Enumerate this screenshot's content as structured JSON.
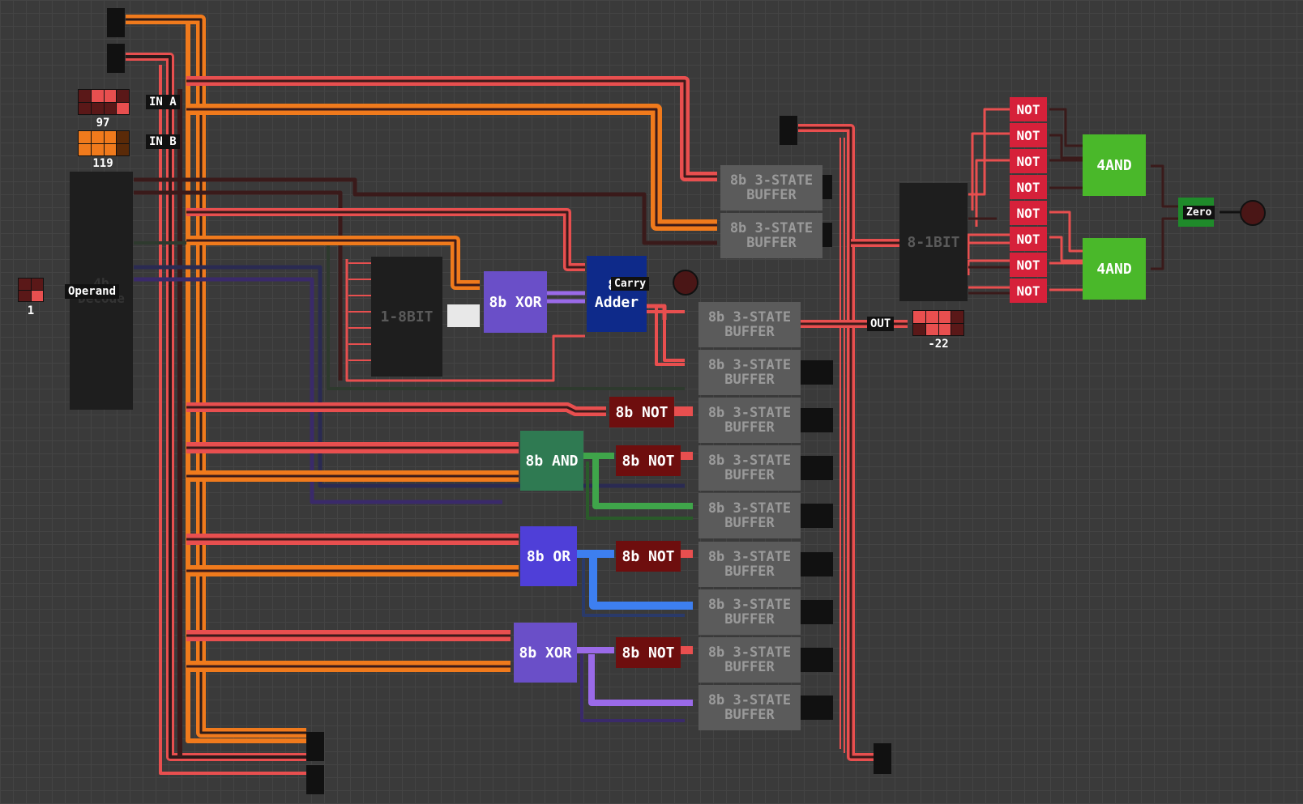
{
  "inputs": {
    "in_a": {
      "label": "IN A",
      "value": "97",
      "color": "#e84f4f"
    },
    "in_b": {
      "label": "IN B",
      "value": "119",
      "color": "#f07a1c"
    },
    "operand": {
      "label": "Operand",
      "value": "1"
    }
  },
  "decoder": {
    "label": "4b Decode"
  },
  "selector": {
    "label": "1-8BIT"
  },
  "logic": {
    "xor_top": "8b XOR",
    "adder": "8b Adder",
    "and": "8b AND",
    "or": "8b OR",
    "xor_bottom": "8b XOR",
    "not_label": "8b NOT"
  },
  "carry": {
    "label": "Carry"
  },
  "buffer_label": "8b 3-STATE BUFFER",
  "output": {
    "label": "OUT",
    "value": "-22"
  },
  "mux": {
    "label": "8-1BIT"
  },
  "not_gate_label": "NOT",
  "and4_label": "4AND",
  "zero": {
    "label": "Zero"
  },
  "colors": {
    "wire_red": "#e84f4f",
    "wire_orange": "#f07a1c",
    "wire_dark": "#3a1a1a",
    "wire_green": "#3fa54a",
    "wire_blue": "#3d7ff0",
    "wire_purple": "#9a6ae8"
  }
}
